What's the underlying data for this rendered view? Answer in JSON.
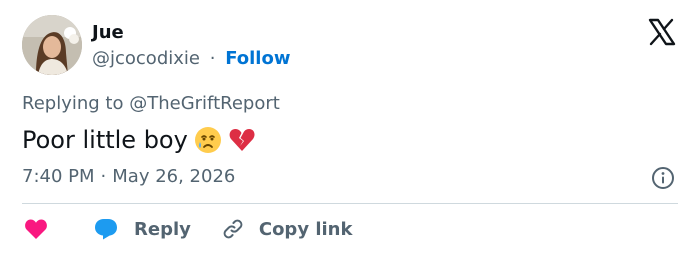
{
  "tweet": {
    "author_name": "Jue",
    "author_handle": "@jcocodixie",
    "separator": "·",
    "follow_label": "Follow",
    "replying_prefix": "Replying to",
    "replying_to": "@TheGriftReport",
    "text": "Poor little boy",
    "emojis": [
      "crying-face-emoji",
      "broken-heart-emoji"
    ],
    "time": "7:40 PM",
    "date": "May 26, 2026"
  },
  "actions": {
    "reply_label": "Reply",
    "copy_link_label": "Copy link"
  },
  "colors": {
    "follow": "#0074d4",
    "secondary_text": "#536471",
    "like_heart": "#f91880",
    "reply_bubble": "#1d9bf0",
    "broken_heart": "#dd2e44"
  }
}
